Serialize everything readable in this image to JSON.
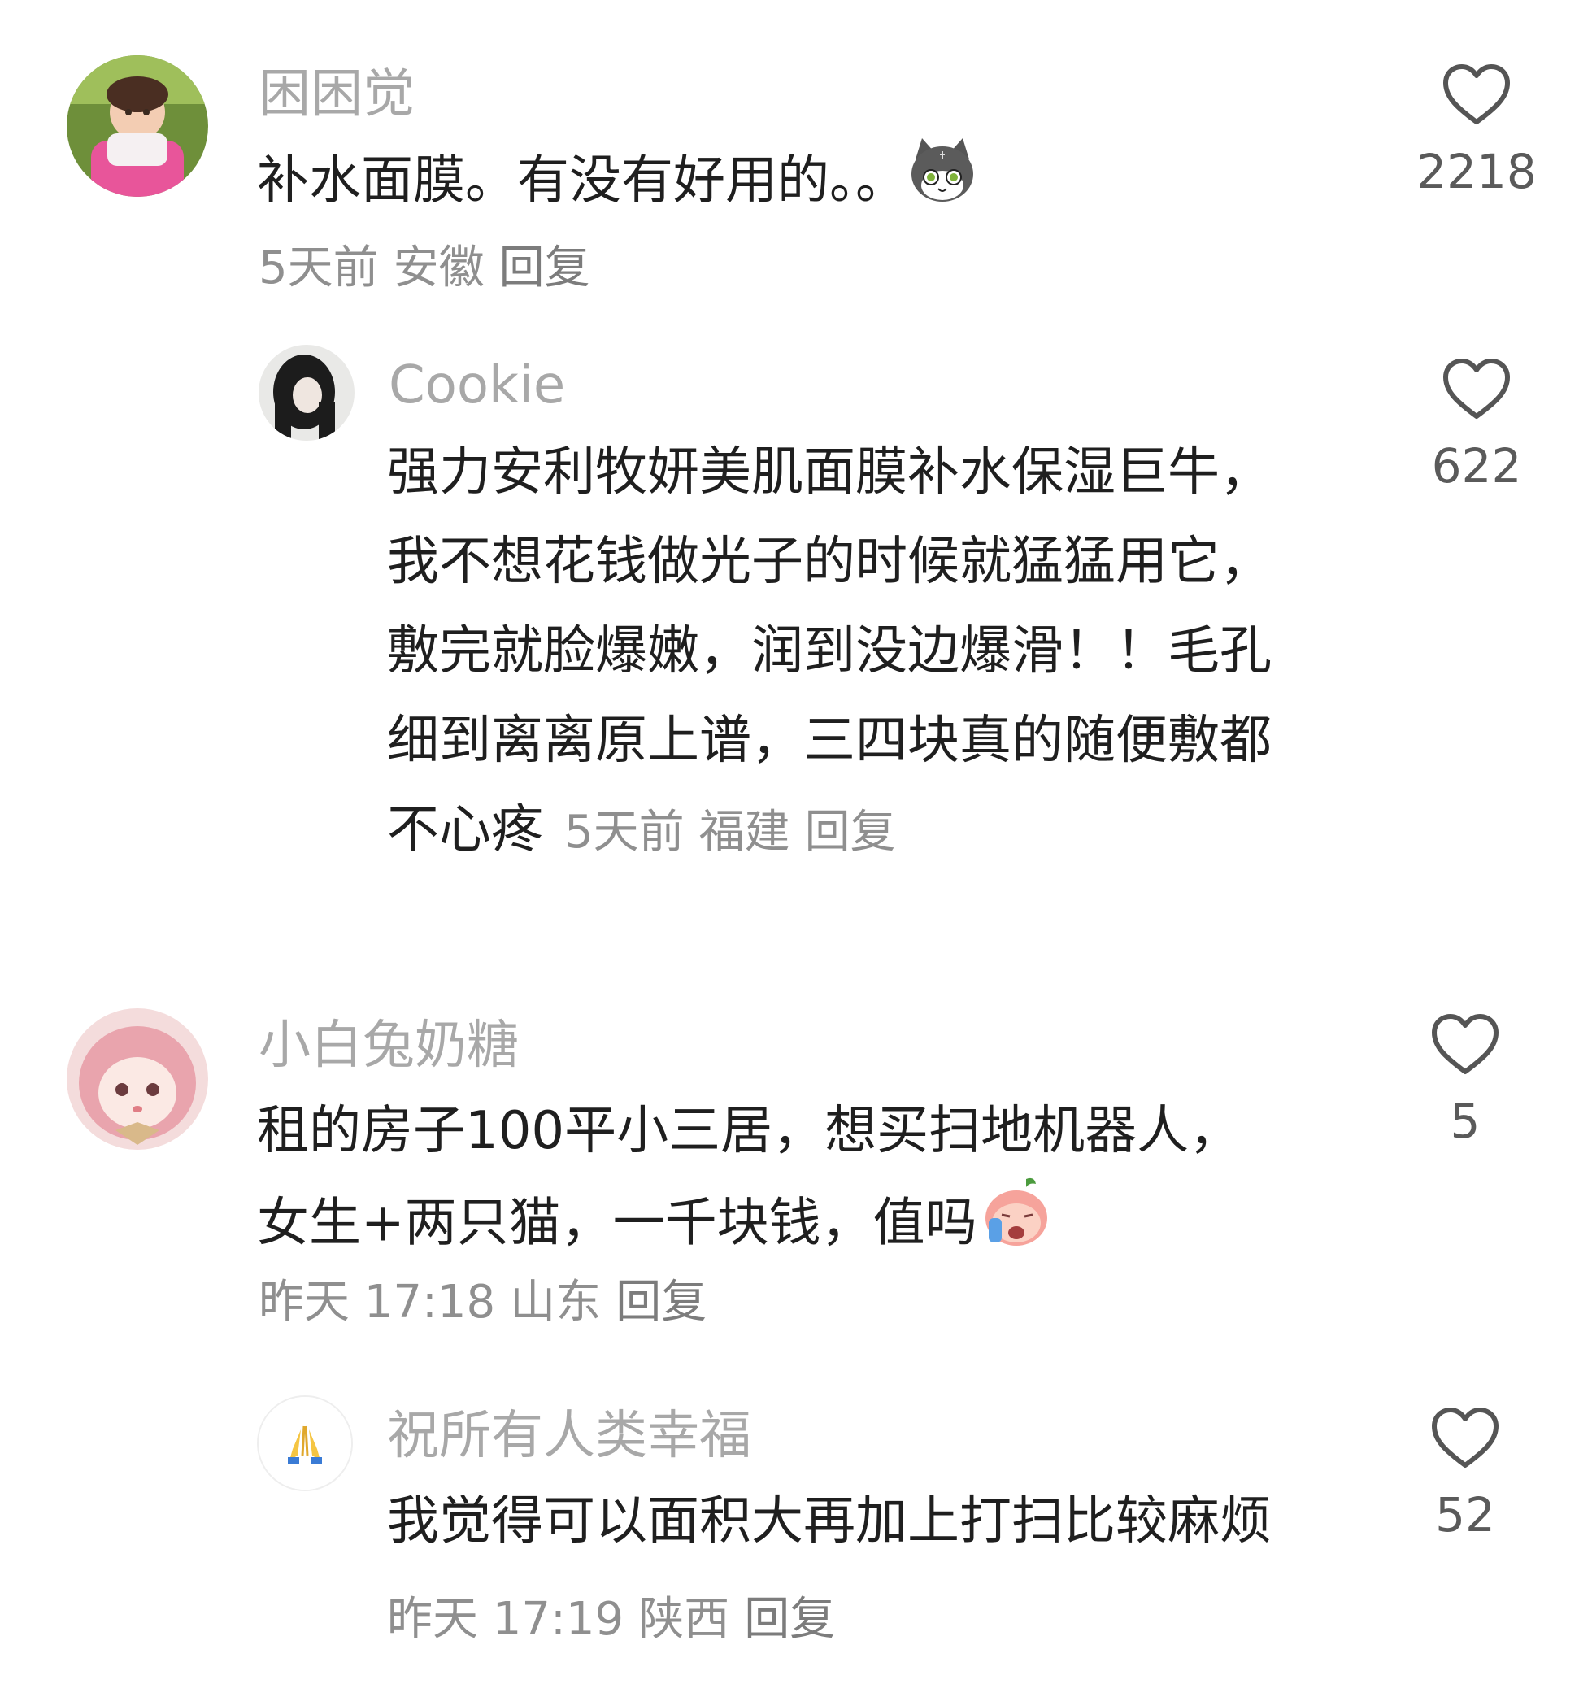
{
  "comments": [
    {
      "username": "困困觉",
      "text": "补水面膜。有没有好用的。。",
      "emoji": "cat-emoji",
      "time": "5天前",
      "location": "安徽",
      "reply": "回复",
      "likes": "2218",
      "replies": [
        {
          "username": "Cookie",
          "lines": [
            "强力安利牧妍美肌面膜补水保湿巨牛，",
            "我不想花钱做光子的时候就猛猛用它，",
            "敷完就脸爆嫩，润到没边爆滑！！毛孔",
            "细到离离原上谱，三四块真的随便敷都",
            "不心疼"
          ],
          "time": "5天前",
          "location": "福建",
          "reply": "回复",
          "likes": "622"
        }
      ]
    },
    {
      "username": "小白兔奶糖",
      "lines": [
        "租的房子100平小三居，想买扫地机器人，",
        "女生+两只猫，一千块钱，值吗"
      ],
      "emoji": "crying-emoji",
      "time": "昨天 17:18",
      "location": "山东",
      "reply": "回复",
      "likes": "5",
      "replies": [
        {
          "username": "祝所有人类幸福",
          "text": "我觉得可以面积大再加上打扫比较麻烦",
          "time": "昨天 17:19",
          "location": "陕西",
          "reply": "回复",
          "likes": "52"
        }
      ]
    }
  ],
  "icons": {
    "like": "heart-outline-icon",
    "avatar_4_glyph": "folded-hands-icon"
  },
  "colors": {
    "username": "#a8a8a8",
    "text": "#1f1f1f",
    "meta": "#8f8f8f",
    "like_icon": "#555555"
  }
}
